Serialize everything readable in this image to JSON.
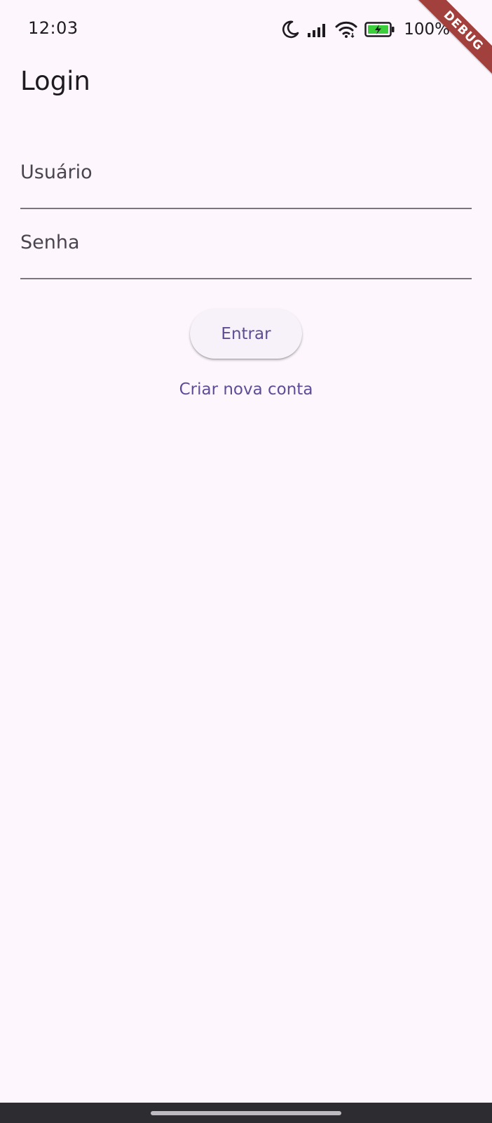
{
  "status_bar": {
    "time": "12:03",
    "battery_percent": "100%",
    "icons": [
      "moon-icon",
      "signal-icon",
      "wifi-icon",
      "battery-charging-icon"
    ]
  },
  "debug_banner": {
    "label": "DEBUG"
  },
  "app_bar": {
    "title": "Login"
  },
  "form": {
    "username": {
      "placeholder": "Usuário",
      "value": ""
    },
    "password": {
      "placeholder": "Senha",
      "value": ""
    },
    "submit_label": "Entrar",
    "create_account_label": "Criar nova conta"
  },
  "colors": {
    "background": "#fdf7fd",
    "accent": "#5d4d97",
    "button_surface": "#f7f2f9",
    "field_underline": "#79747e",
    "debug_ribbon": "#a2403d",
    "battery_green": "#3ccf3c"
  }
}
